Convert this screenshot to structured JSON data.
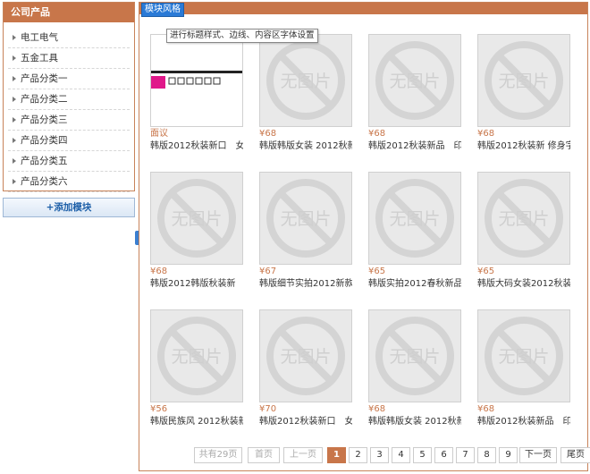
{
  "sidebar": {
    "title": "公司产品",
    "items": [
      {
        "label": "电工电气"
      },
      {
        "label": "五金工具"
      },
      {
        "label": "产品分类一"
      },
      {
        "label": "产品分类二"
      },
      {
        "label": "产品分类三"
      },
      {
        "label": "产品分类四"
      },
      {
        "label": "产品分类五"
      },
      {
        "label": "产品分类六"
      }
    ],
    "add_label": "+添加模块"
  },
  "main": {
    "style_tag": "模块风格",
    "tooltip": "进行标题样式、边线、内容区字体设置",
    "placeholder_text": "无图片",
    "products": [
      {
        "price": "面议",
        "name": "韩版2012秋装新口　女",
        "thumb": "screenshot"
      },
      {
        "price": "¥68",
        "name": "韩版韩版女装 2012秋款",
        "thumb": "none"
      },
      {
        "price": "¥68",
        "name": "韩版2012秋装新品　印",
        "thumb": "none"
      },
      {
        "price": "¥68",
        "name": "韩版2012秋装新 修身字",
        "thumb": "none"
      },
      {
        "price": "¥68",
        "name": "韩版2012韩版秋装新",
        "thumb": "none"
      },
      {
        "price": "¥67",
        "name": "韩版细节实拍2012新款",
        "thumb": "none"
      },
      {
        "price": "¥65",
        "name": "韩版实拍2012春秋新品",
        "thumb": "none"
      },
      {
        "price": "¥65",
        "name": "韩版大码女装2012秋装",
        "thumb": "none"
      },
      {
        "price": "¥56",
        "name": "韩版民族风 2012秋装新",
        "thumb": "none"
      },
      {
        "price": "¥70",
        "name": "韩版2012秋装新口　女",
        "thumb": "none"
      },
      {
        "price": "¥68",
        "name": "韩版韩版女装 2012秋款",
        "thumb": "none"
      },
      {
        "price": "¥68",
        "name": "韩版2012秋装新品　印",
        "thumb": "none"
      }
    ]
  },
  "pager": {
    "total": "共有29页",
    "first": "首页",
    "prev": "上一页",
    "pages": [
      "1",
      "2",
      "3",
      "4",
      "5",
      "6",
      "7",
      "8",
      "9"
    ],
    "current": "1",
    "next": "下一页",
    "last": "尾页"
  },
  "colors": {
    "accent": "#c8764a",
    "link_blue": "#2a7ad6"
  }
}
